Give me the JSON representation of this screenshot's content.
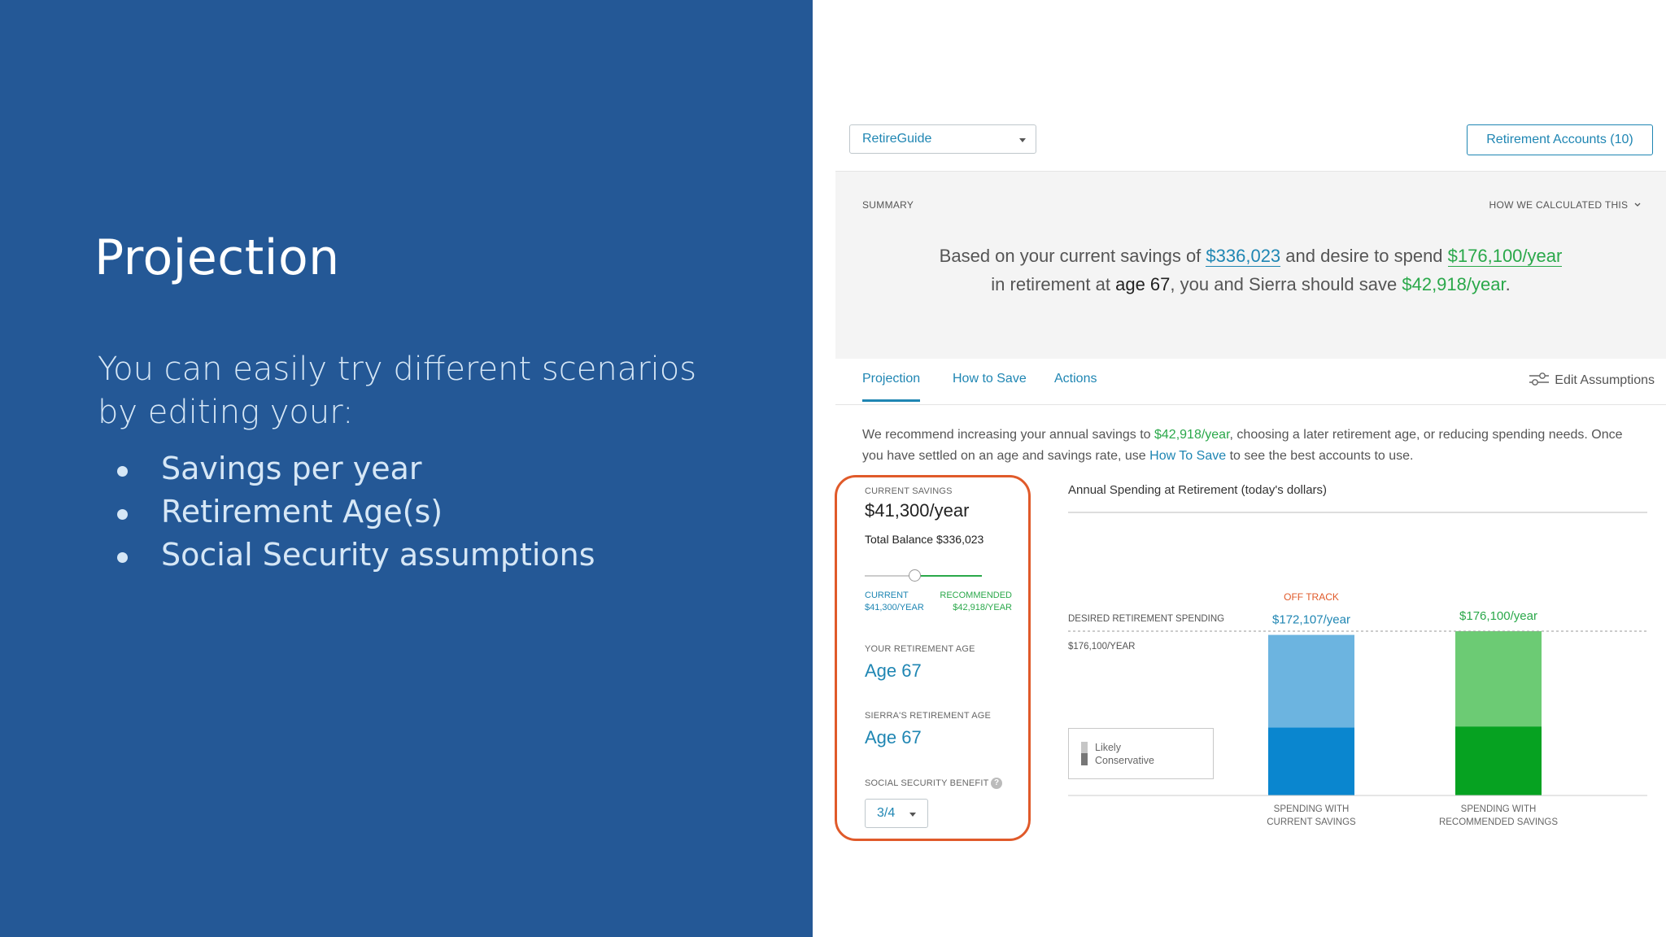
{
  "slide": {
    "title": "Projection",
    "intro": "You can easily try different scenarios by editing your:",
    "bullets": [
      "Savings per year",
      "Retirement Age(s)",
      "Social Security assumptions"
    ]
  },
  "app": {
    "selector_value": "RetireGuide",
    "accounts_button": "Retirement Accounts (10)",
    "summary": {
      "label": "SUMMARY",
      "how_calculated": "HOW WE CALCULATED THIS",
      "t1": "Based on your current savings of ",
      "savings": "$336,023",
      "t2": " and desire to spend ",
      "spend": "$176,100/year",
      "t3": "in retirement at ",
      "age": "age 67",
      "t4": ", you and Sierra should save ",
      "save": "$42,918/year",
      "t5": "."
    },
    "tabs": [
      {
        "label": "Projection",
        "active": true
      },
      {
        "label": "How to Save",
        "active": false
      },
      {
        "label": "Actions",
        "active": false
      }
    ],
    "edit_assumptions": "Edit Assumptions",
    "recommendation": {
      "t1": "We recommend increasing your annual savings to ",
      "amount": "$42,918/year",
      "t2": ", choosing a later retirement age, or reducing spending needs. Once you have settled on an age and savings rate, use ",
      "link": "How To Save",
      "t3": " to see the best accounts to use."
    },
    "controls": {
      "current_savings_label": "CURRENT SAVINGS",
      "current_savings_value": "$41,300/year",
      "total_balance": "Total Balance $336,023",
      "slider_current_label": "CURRENT",
      "slider_current_value": "$41,300/YEAR",
      "slider_recommended_label": "RECOMMENDED",
      "slider_recommended_value": "$42,918/YEAR",
      "retirement_age_label": "YOUR RETIREMENT AGE",
      "retirement_age_value": "Age 67",
      "sierra_age_label": "SIERRA'S RETIREMENT AGE",
      "sierra_age_value": "Age 67",
      "ss_label": "SOCIAL SECURITY BENEFIT",
      "ss_help": "?",
      "ss_value": "3/4"
    },
    "colors": {
      "accent": "#1f86b3",
      "green": "#2aa84a",
      "offtrack": "#e05a2a",
      "panel": "#245896"
    }
  },
  "chart_data": {
    "type": "bar",
    "title": "Annual Spending at Retirement (today's dollars)",
    "categories": [
      "SPENDING WITH CURRENT SAVINGS",
      "SPENDING WITH RECOMMENDED SAVINGS"
    ],
    "category_lines": [
      [
        "SPENDING WITH",
        "CURRENT SAVINGS"
      ],
      [
        "SPENDING WITH",
        "RECOMMENDED SAVINGS"
      ]
    ],
    "series": [
      {
        "name": "Conservative",
        "values": [
          73000,
          74000
        ]
      },
      {
        "name": "Likely",
        "values": [
          99107,
          102100
        ]
      }
    ],
    "totals": [
      172107,
      176100
    ],
    "bar_labels": [
      "$172,107/year",
      "$176,100/year"
    ],
    "status_label": "OFF TRACK",
    "reference_line": {
      "value": 176100,
      "label": "DESIRED RETIREMENT SPENDING",
      "value_label": "$176,100/YEAR"
    },
    "legend": [
      "Likely",
      "Conservative"
    ],
    "colors": {
      "current": {
        "likely": "#6cb4e0",
        "conservative": "#0a86cf"
      },
      "recommended": {
        "likely": "#6ccb74",
        "conservative": "#06a221"
      }
    },
    "ylim": [
      0,
      176100
    ]
  }
}
